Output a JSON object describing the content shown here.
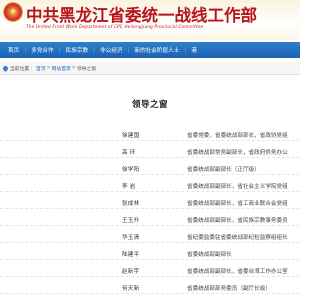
{
  "header": {
    "title": "中共黑龙江省委统一战线工作部",
    "subtitle": "The United Front Work Department of CPC Heilongjiang Provincial Committee"
  },
  "nav": {
    "items": [
      {
        "label": "首页"
      },
      {
        "label": "多党合作"
      },
      {
        "label": "民族宗教"
      },
      {
        "label": "非公经济"
      },
      {
        "label": "新的社会阶层人士"
      },
      {
        "label": "港"
      }
    ]
  },
  "breadcrumb": {
    "prefix": "当前位置",
    "items": [
      "首页",
      "网站首页",
      "领导之窗"
    ]
  },
  "page": {
    "title": "领导之窗"
  },
  "leaders": [
    {
      "name": "徐建国",
      "title": "省委常委，省委统战部部长，省政协党组"
    },
    {
      "name": "高  环",
      "title": "省委统战部常务副部长，省政府侨务办公"
    },
    {
      "name": "徐学阳",
      "title": "省委统战部副部长（正厅级）"
    },
    {
      "name": "李  岩",
      "title": "省委统战部副部长，省社会主义学院党组"
    },
    {
      "name": "张成林",
      "title": "省委统战部副部长，省工商业联合会党组"
    },
    {
      "name": "王玉升",
      "title": "省委统战部副部长，省民族宗教事务委员"
    },
    {
      "name": "华玉清",
      "title": "省纪委监委驻省委统战部纪检监察组组长"
    },
    {
      "name": "陆建平",
      "title": "省委统战部副部长"
    },
    {
      "name": "赵新宇",
      "title": "省委统战部副部长，省委台湾工作办公室"
    },
    {
      "name": "何天新",
      "title": "省委统战部部务委员（副厅长级）"
    }
  ]
}
